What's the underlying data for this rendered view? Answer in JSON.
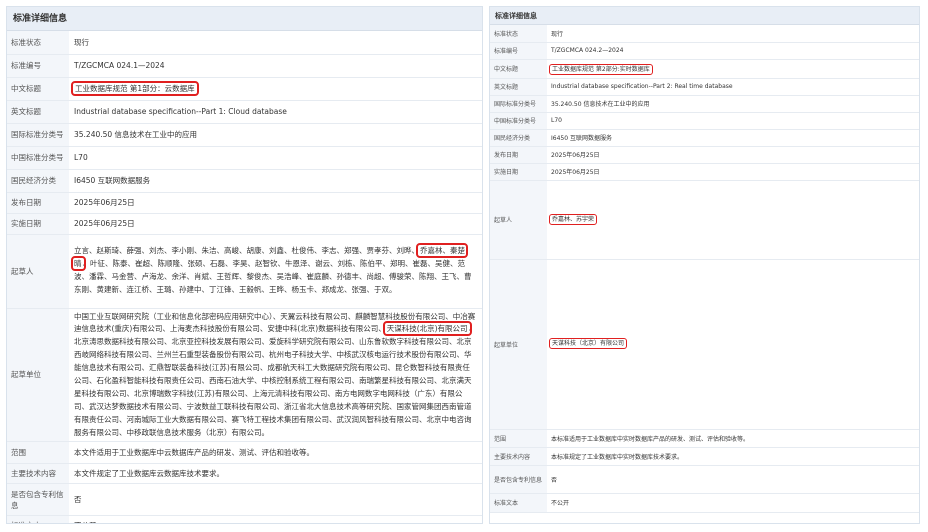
{
  "left": {
    "header": "标准详细信息",
    "rows": {
      "status": {
        "label": "标准状态",
        "value": "现行"
      },
      "number": {
        "label": "标准编号",
        "value": "T/ZGCMCA 024.1—2024"
      },
      "cn_title": {
        "label": "中文标题",
        "value": "工业数据库规范 第1部分：云数据库"
      },
      "en_title": {
        "label": "英文标题",
        "value": "Industrial database specification--Part 1: Cloud database"
      },
      "ics": {
        "label": "国际标准分类号",
        "value": "35.240.50 信息技术在工业中的应用"
      },
      "ccs": {
        "label": "中国标准分类号",
        "value": "L70"
      },
      "econ": {
        "label": "国民经济分类",
        "value": "I6450 互联网数据服务"
      },
      "publish": {
        "label": "发布日期",
        "value": "2025年06月25日"
      },
      "implement": {
        "label": "实施日期",
        "value": "2025年06月25日"
      },
      "drafters": {
        "label": "起草人",
        "before": "立言、赵斯琦、薛强、刘杰、李小刚、朱洁、高峻、胡康、刘鑫、杜俊伟、李志、郑强、贾孝芬、刘晔、",
        "highlight": "乔嘉林、秦楚晴",
        "after": "、叶征、陈泰、崔超、陈顺隆、张硕、石磊、李昊、赵智钦、牛恩泽、谢云、刘栋、陈伯平、郑明、崔磊、吴健、范波、潘霖、马金营、卢海龙、余洋、肖斌、王哲辉、黎俊杰、吴浩峰、崔庭麟、孙德丰、尚超、傅骏荣、陈翔、王飞、曹东刚、黄建新、连江桥、王璐、孙建中、丁江锋、王毅帆、王晔、杨玉卡、郑成龙、张强、于双。"
      },
      "units": {
        "label": "起草单位",
        "before": "中国工业互联网研究院（工业和信息化部密码应用研究中心）、天翼云科技有限公司、麒麟智慧科技股份有限公司、中冶赛迪信息技术(重庆)有限公司、上海麦杰科技股份有限公司、安捷中科(北京)数据科技有限公司、",
        "highlight": "天谋科技(北京)有限公司",
        "after": "、北京涛思数据科技有限公司、北京亚控科技发展有限公司、爱旋科学研究院有限公司、山东鲁软数字科技有限公司、北京西岐网络科技有限公司、兰州兰石重型装备股份有限公司、杭州电子科技大学、中核武汉核电运行技术股份有限公司、华能信息技术有限公司、汇鼎智联装备科技(江苏)有限公司、成都航天科工大数据研究院有限公司、昆仑数智科技有限责任公司、石化盈科智能科技有限责任公司、西南石油大学、中核控制系统工程有限公司、南瑞繁星科技有限公司、北京满天星科技有限公司、北京博瑞数字科技(江苏)有限公司、上海元清科技有限公司、南方电网数字电网科技（广东）有限公司、武汉达梦数据技术有限公司、宁波数益工联科技有限公司、浙江省北大信息技术高等研究院、国家管网集团西南管道有限责任公司、河南城际工业大数据有限公司、赛飞特工程技术集团有限公司、武汉润风智科技有限公司、北京中电咨询服务有限公司、中移政联信息技术服务（北京）有限公司。"
      },
      "scope": {
        "label": "范围",
        "value": "本文件适用于工业数据库中云数据库产品的研发、测试、评估和验收等。"
      },
      "main_content": {
        "label": "主要技术内容",
        "value": "本文件规定了工业数据库云数据库技术要求。"
      },
      "patent": {
        "label": "是否包含专利信息",
        "value": "否"
      },
      "full_text": {
        "label": "标准文本",
        "value": "不公开"
      }
    }
  },
  "right": {
    "header": "标准详细信息",
    "rows": {
      "status": {
        "label": "标准状态",
        "value": "现行"
      },
      "number": {
        "label": "标准编号",
        "value": "T/ZGCMCA 024.2—2024"
      },
      "cn_title": {
        "label": "中文标题",
        "value": "工业数据库规范 第2部分:实时数据库"
      },
      "en_title": {
        "label": "英文标题",
        "value": "Industrial database specification--Part 2: Real time database"
      },
      "ics": {
        "label": "国际标准分类号",
        "value": "35.240.50 信息技术在工业中的应用"
      },
      "ccs": {
        "label": "中国标准分类号",
        "value": "L70"
      },
      "econ": {
        "label": "国民经济分类",
        "value": "I6450 互联网数据服务"
      },
      "publish": {
        "label": "发布日期",
        "value": "2025年06月25日"
      },
      "implement": {
        "label": "实施日期",
        "value": "2025年06月25日"
      },
      "drafters": {
        "label": "起草人",
        "before": "",
        "highlight": "乔嘉林、苏宇荣",
        "after": ""
      },
      "units": {
        "label": "起草单位",
        "before": "",
        "highlight": "天谋科技（北京）有限公司",
        "after": ""
      },
      "scope": {
        "label": "范围",
        "value": "本标准适用于工业数据库中实时数据库产品的研发、测试、评估和验收等。"
      },
      "main_content": {
        "label": "主要技术内容",
        "value": "本标准规定了工业数据库中实时数据库技术要求。"
      },
      "patent": {
        "label": "是否包含专利信息",
        "value": "否"
      },
      "full_text": {
        "label": "标准文本",
        "value": "不公开"
      }
    }
  }
}
